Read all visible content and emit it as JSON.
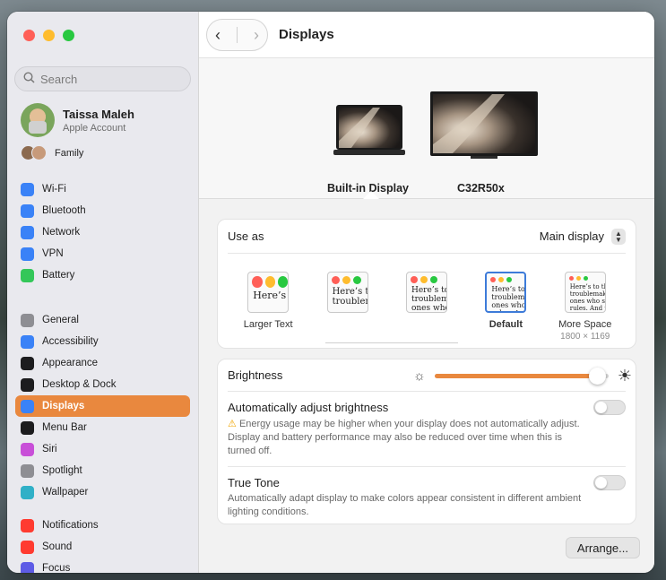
{
  "window": {
    "title": "Displays"
  },
  "search": {
    "placeholder": "Search"
  },
  "profile": {
    "name": "Taissa Maleh",
    "subtitle": "Apple Account"
  },
  "family": {
    "label": "Family"
  },
  "sidebar": {
    "group1": [
      {
        "label": "Wi-Fi",
        "icon": "wifi-icon",
        "color": "#3a82f7"
      },
      {
        "label": "Bluetooth",
        "icon": "bluetooth-icon",
        "color": "#3a82f7"
      },
      {
        "label": "Network",
        "icon": "network-icon",
        "color": "#3a82f7"
      },
      {
        "label": "VPN",
        "icon": "vpn-icon",
        "color": "#3a82f7"
      },
      {
        "label": "Battery",
        "icon": "battery-icon",
        "color": "#34c759"
      }
    ],
    "group2": [
      {
        "label": "General",
        "icon": "gear-icon",
        "color": "#8e8e93"
      },
      {
        "label": "Accessibility",
        "icon": "accessibility-icon",
        "color": "#3a82f7"
      },
      {
        "label": "Appearance",
        "icon": "appearance-icon",
        "color": "#1c1c1e"
      },
      {
        "label": "Desktop & Dock",
        "icon": "dock-icon",
        "color": "#1c1c1e"
      },
      {
        "label": "Displays",
        "icon": "displays-icon",
        "color": "#3a82f7",
        "selected": true
      },
      {
        "label": "Menu Bar",
        "icon": "menu-bar-icon",
        "color": "#1c1c1e"
      },
      {
        "label": "Siri",
        "icon": "siri-icon",
        "color": "#c84fd8"
      },
      {
        "label": "Spotlight",
        "icon": "spotlight-icon",
        "color": "#8e8e93"
      },
      {
        "label": "Wallpaper",
        "icon": "wallpaper-icon",
        "color": "#30b0c7"
      }
    ],
    "group3": [
      {
        "label": "Notifications",
        "icon": "notifications-icon",
        "color": "#ff3b30"
      },
      {
        "label": "Sound",
        "icon": "sound-icon",
        "color": "#ff3b30"
      },
      {
        "label": "Focus",
        "icon": "focus-icon",
        "color": "#5e5ce6"
      }
    ]
  },
  "displays": {
    "items": [
      {
        "label": "Built-in Display",
        "selected": true
      },
      {
        "label": "C32R50x",
        "selected": false
      }
    ]
  },
  "use_as": {
    "label": "Use as",
    "value": "Main display"
  },
  "resolutions": [
    {
      "label": "Larger Text",
      "preview": "Here’s",
      "sub": ""
    },
    {
      "label": "",
      "preview": "Here’s to the\ntroublem",
      "sub": ""
    },
    {
      "label": "",
      "preview": "Here’s to the\ntroublema\nones who se\ngoes who",
      "sub": ""
    },
    {
      "label": "Default",
      "preview": "Here’s to the cr\ntroublemakers.\nones who see th\nrules. And they",
      "sub": "",
      "selected": true
    },
    {
      "label": "More Space",
      "preview": "Here’s to the crazy ones\ntroublemakers. The round\nones who see things diff\nrules. And they have no\ncan quote them, disagree\nthem. About the only th\nBecause they change th",
      "sub": "1800 × 1169"
    }
  ],
  "brightness": {
    "label": "Brightness",
    "level": 0.94
  },
  "auto_brightness": {
    "label": "Automatically adjust brightness",
    "warning": "Energy usage may be higher when your display does not automatically adjust. Display and battery performance may also be reduced over time when this is turned off.",
    "on": false
  },
  "true_tone": {
    "label": "True Tone",
    "description": "Automatically adapt display to make colors appear consistent in different ambient lighting conditions.",
    "on": false
  },
  "arrange_button": {
    "label": "Arrange..."
  },
  "colors": {
    "accent": "#e9883e",
    "selection_blue": "#3d7bd9"
  }
}
